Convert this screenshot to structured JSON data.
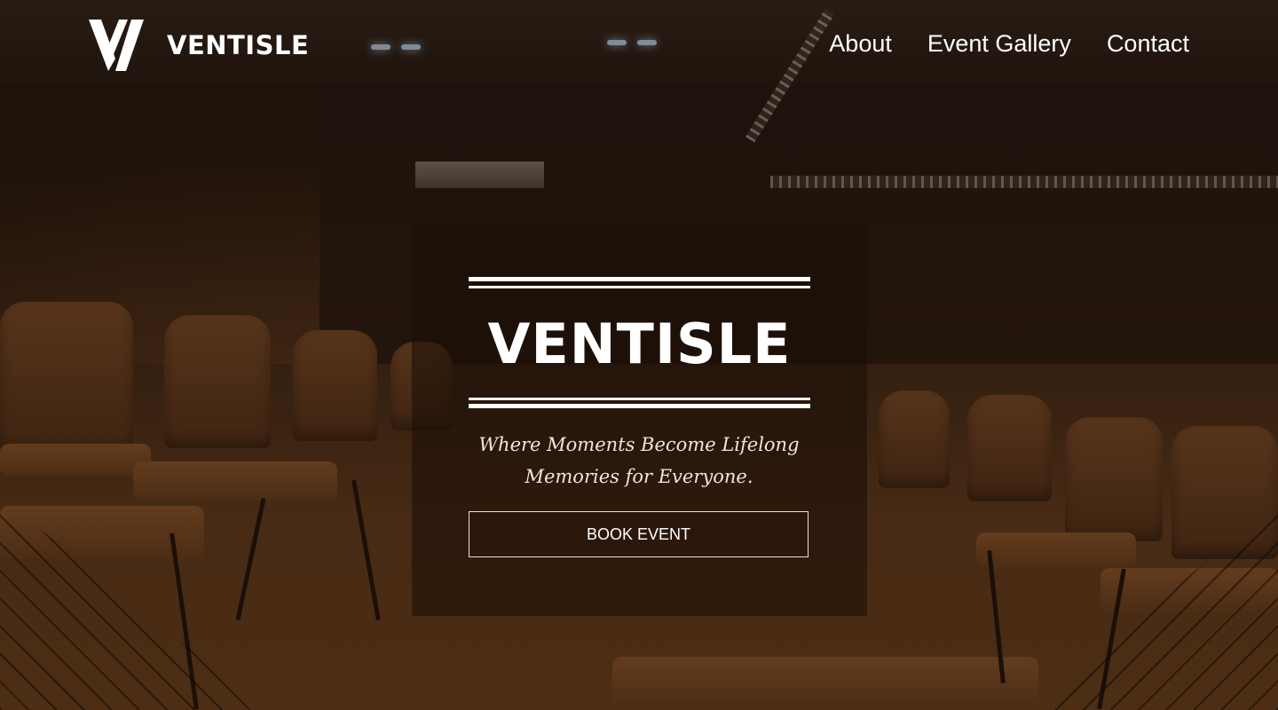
{
  "header": {
    "logo_text": "VENTISLE",
    "nav": [
      {
        "label": "About"
      },
      {
        "label": "Event Gallery"
      },
      {
        "label": "Contact"
      }
    ]
  },
  "hero": {
    "title": "VENTISLE",
    "tagline_line1": "Where Moments Become Lifelong",
    "tagline_line2": "Memories for Everyone.",
    "cta_label": "BOOK EVENT"
  },
  "colors": {
    "text": "#ffffff",
    "overlay": "#1e1006",
    "background": "#3a2414"
  }
}
